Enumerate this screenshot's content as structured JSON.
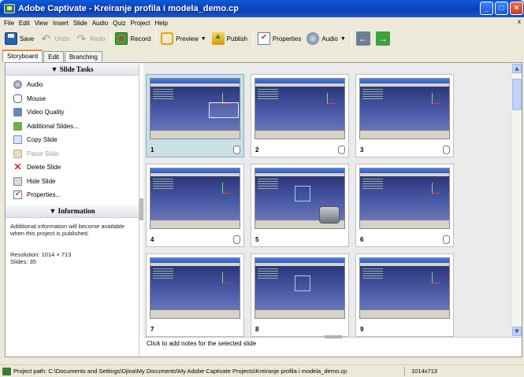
{
  "window": {
    "title": "Adobe Captivate - Kreiranje profila i modela_demo.cp"
  },
  "menu": [
    "File",
    "Edit",
    "View",
    "Insert",
    "Slide",
    "Audio",
    "Quiz",
    "Project",
    "Help"
  ],
  "menu_close": "x",
  "toolbar": {
    "save": "Save",
    "undo": "Undo",
    "redo": "Redo",
    "record": "Record",
    "preview": "Preview",
    "publish": "Publish",
    "properties": "Properties",
    "audio": "Audio"
  },
  "tabs": [
    "Storyboard",
    "Edit",
    "Branching"
  ],
  "slide_tasks": {
    "header": "Slide Tasks",
    "items": [
      {
        "label": "Audio",
        "icon": "audio-icon",
        "enabled": true
      },
      {
        "label": "Mouse",
        "icon": "mouse-icon",
        "enabled": true
      },
      {
        "label": "Video Quality",
        "icon": "video-quality-icon",
        "enabled": true
      },
      {
        "label": "Additional Slides...",
        "icon": "additional-slides-icon",
        "enabled": true
      },
      {
        "label": "Copy Slide",
        "icon": "copy-icon",
        "enabled": true
      },
      {
        "label": "Paste Slide",
        "icon": "paste-icon",
        "enabled": false
      },
      {
        "label": "Delete Slide",
        "icon": "delete-icon",
        "enabled": true
      },
      {
        "label": "Hide Slide",
        "icon": "hide-icon",
        "enabled": true
      },
      {
        "label": "Properties...",
        "icon": "properties-icon",
        "enabled": true
      }
    ]
  },
  "information": {
    "header": "Information",
    "message": "Additional information will become available when this project is published.",
    "resolution": "Resolution: 1014 × 713",
    "slides": "Slides: 35"
  },
  "slides": [
    {
      "number": "1",
      "selected": true
    },
    {
      "number": "2",
      "selected": false
    },
    {
      "number": "3",
      "selected": false
    },
    {
      "number": "4",
      "selected": false
    },
    {
      "number": "5",
      "selected": false
    },
    {
      "number": "6",
      "selected": false
    },
    {
      "number": "7",
      "selected": false
    },
    {
      "number": "8",
      "selected": false
    },
    {
      "number": "9",
      "selected": false
    }
  ],
  "notes": {
    "placeholder": "Click to add notes for the selected slide"
  },
  "statusbar": {
    "path": "Project path: C:\\Documents and Settings\\Djina\\My Documents\\My Adobe Captivate Projects\\Kreiranje profila i modela_demo.cp",
    "resolution": "1014x713"
  }
}
